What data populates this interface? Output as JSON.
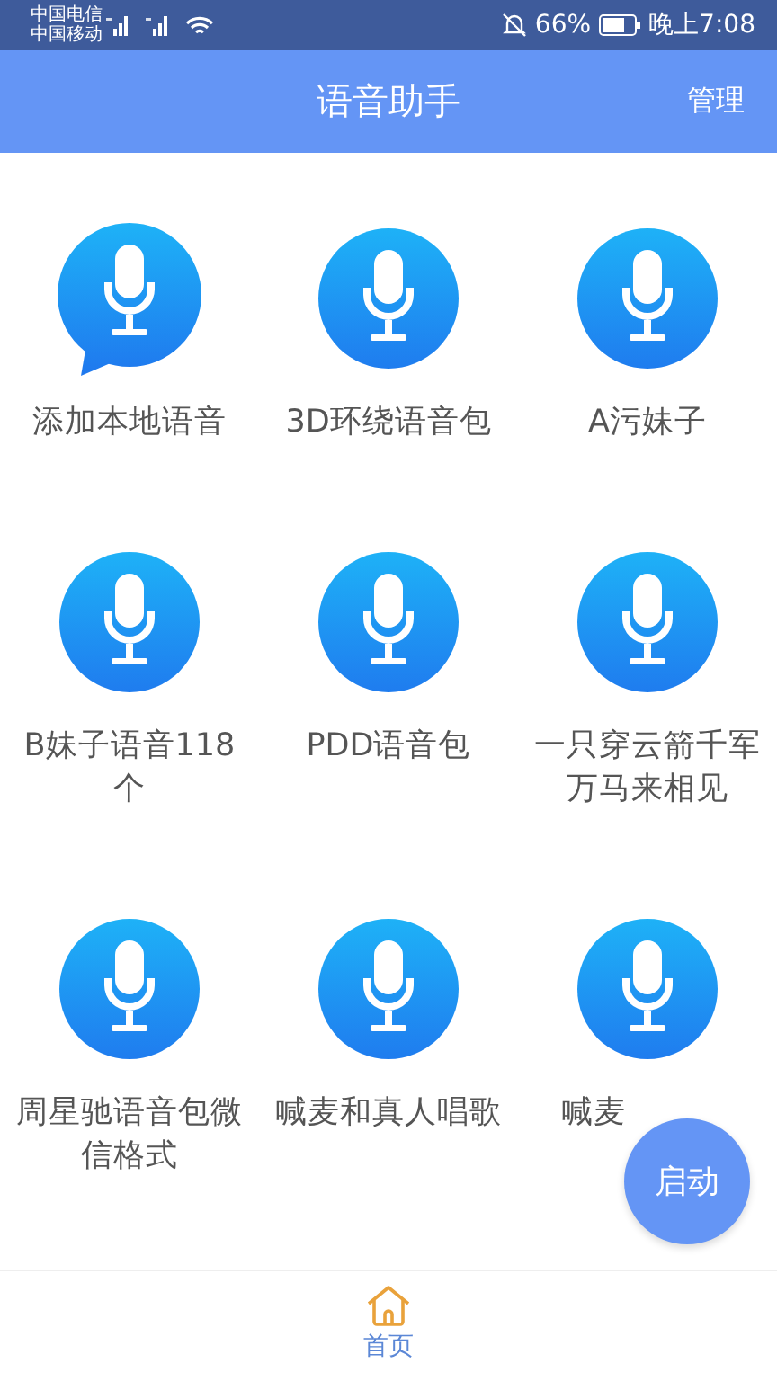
{
  "status_bar": {
    "carriers": [
      "中国电信",
      "中国移动"
    ],
    "battery": "66%",
    "time": "晚上7:08"
  },
  "header": {
    "title": "语音助手",
    "action": "管理"
  },
  "items": [
    {
      "kind": "bubble",
      "label": "添加本地语音"
    },
    {
      "kind": "circle",
      "label": "3D环绕语音包"
    },
    {
      "kind": "circle",
      "label": "A污妹子"
    },
    {
      "kind": "circle",
      "label": "B妹子语音118个"
    },
    {
      "kind": "circle",
      "label": "PDD语音包"
    },
    {
      "kind": "circle",
      "label": "一只穿云箭千军万马来相见"
    },
    {
      "kind": "circle",
      "label": "周星驰语音包微信格式"
    },
    {
      "kind": "circle",
      "label": "喊麦和真人唱歌"
    },
    {
      "kind": "circle",
      "label": "喊麦",
      "cut": true
    }
  ],
  "fab": {
    "label": "启动"
  },
  "tabs": [
    {
      "label": "首页",
      "selected": true
    }
  ]
}
